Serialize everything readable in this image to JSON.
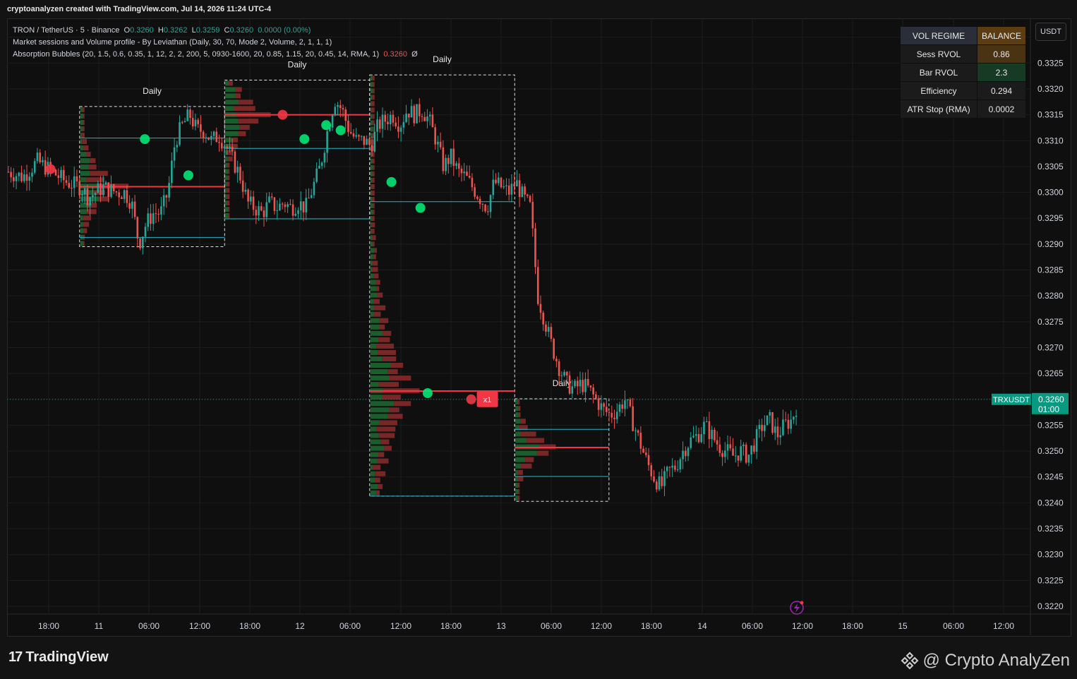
{
  "header": {
    "text": "cryptoanalyzen created with TradingView.com, Jul 14, 2026 11:24 UTC-4"
  },
  "legend": {
    "symbol_line": "TRON / TetherUS · 5 · Binance",
    "o_label": "O",
    "o_value": "0.3260",
    "h_label": "H",
    "h_value": "0.3262",
    "l_label": "L",
    "l_value": "0.3259",
    "c_label": "C",
    "c_value": "0.3260",
    "change": "0.0000 (0.00%)",
    "indicator1": "Market sessions and Volume profile - By Leviathan (Daily, 30, 70, Mode 2, Volume, 2, 1, 1, 1)",
    "indicator2": "Absorption Bubbles (20, 1.5, 0.6, 0.35, 1, 12, 2, 2, 200, 5, 0930-1600, 20, 0.85, 1.15, 20, 0.45, 14, RMA, 1)",
    "indicator2_value": "0.3260",
    "indicator2_suffix": "Ø"
  },
  "currency_button": "USDT",
  "regime_table": {
    "header": [
      "VOL REGIME",
      "BALANCE"
    ],
    "rows": [
      {
        "label": "Sess RVOL",
        "value": "0.86"
      },
      {
        "label": "Bar RVOL",
        "value": "2.3"
      },
      {
        "label": "Efficiency",
        "value": "0.294"
      },
      {
        "label": "ATR Stop (RMA)",
        "value": "0.0002"
      }
    ],
    "colors": {
      "header_bg": "#2a2e39",
      "balance_bg": "#5c3d12",
      "row_bg": "#1b1b1b",
      "sess_value_bg": "#4a3312",
      "bar_value_bg": "#173a24"
    }
  },
  "price_tag": {
    "symbol": "TRXUSDT",
    "price": "0.3260",
    "countdown": "01:00",
    "color": "#089981"
  },
  "session_label": "Daily",
  "marker_label": "x1",
  "footer": {
    "logo_text": "TradingView",
    "brand": "@ Crypto AnalyZen"
  },
  "colors": {
    "up": "#26a69a",
    "down": "#ef5350",
    "poc": "#f23645",
    "va": "#22b5c9",
    "bubble_green": "#00e676",
    "bubble_red": "#f23645"
  },
  "chart_data": {
    "type": "candlestick",
    "symbol": "TRXUSDT",
    "timeframe": "5",
    "ylim": [
      0.32185,
      0.33335
    ],
    "y_ticks": [
      "0.3330",
      "0.3325",
      "0.3320",
      "0.3315",
      "0.3310",
      "0.3305",
      "0.3300",
      "0.3295",
      "0.3290",
      "0.3285",
      "0.3280",
      "0.3275",
      "0.3270",
      "0.3265",
      "0.3260",
      "0.3255",
      "0.3250",
      "0.3245",
      "0.3240",
      "0.3235",
      "0.3230",
      "0.3225",
      "0.3220"
    ],
    "x_ticks": [
      "18:00",
      "11",
      "06:00",
      "12:00",
      "18:00",
      "12",
      "06:00",
      "12:00",
      "18:00",
      "13",
      "06:00",
      "12:00",
      "18:00",
      "14",
      "06:00",
      "12:00",
      "18:00",
      "15",
      "06:00",
      "12:00"
    ],
    "price_path": [
      [
        0,
        0.3304
      ],
      [
        2,
        0.3303
      ],
      [
        4,
        0.3306
      ],
      [
        6,
        0.3304
      ],
      [
        8,
        0.3302
      ],
      [
        10,
        0.3301
      ],
      [
        11,
        0.3299
      ],
      [
        13,
        0.3301
      ],
      [
        15,
        0.33
      ],
      [
        16,
        0.33
      ],
      [
        17,
        0.3298
      ],
      [
        18,
        0.329
      ],
      [
        19,
        0.3294
      ],
      [
        20,
        0.3296
      ],
      [
        21,
        0.3296
      ],
      [
        22,
        0.33
      ],
      [
        23,
        0.331
      ],
      [
        24,
        0.3313
      ],
      [
        25,
        0.3315
      ],
      [
        26,
        0.3312
      ],
      [
        27,
        0.3312
      ],
      [
        28,
        0.331
      ],
      [
        29,
        0.3311
      ],
      [
        30,
        0.3309
      ],
      [
        31,
        0.3306
      ],
      [
        32,
        0.3303
      ],
      [
        33,
        0.3298
      ],
      [
        34,
        0.3297
      ],
      [
        35,
        0.3296
      ],
      [
        36,
        0.3298
      ],
      [
        37,
        0.3297
      ],
      [
        38,
        0.3298
      ],
      [
        39,
        0.3297
      ],
      [
        40,
        0.3298
      ],
      [
        41,
        0.3297
      ],
      [
        42,
        0.3301
      ],
      [
        43,
        0.3305
      ],
      [
        44,
        0.3312
      ],
      [
        45,
        0.3318
      ],
      [
        46,
        0.3316
      ],
      [
        47,
        0.3312
      ],
      [
        48,
        0.331
      ],
      [
        49,
        0.331
      ],
      [
        50,
        0.3309
      ],
      [
        51,
        0.3313
      ],
      [
        52,
        0.3314
      ],
      [
        53,
        0.3315
      ],
      [
        54,
        0.3313
      ],
      [
        55,
        0.3316
      ],
      [
        56,
        0.3315
      ],
      [
        57,
        0.3316
      ],
      [
        58,
        0.3314
      ],
      [
        59,
        0.331
      ],
      [
        60,
        0.3305
      ],
      [
        61,
        0.3307
      ],
      [
        62,
        0.3304
      ],
      [
        63,
        0.3303
      ],
      [
        64,
        0.3301
      ],
      [
        65,
        0.3299
      ],
      [
        66,
        0.3297
      ],
      [
        67,
        0.3302
      ],
      [
        68,
        0.3301
      ],
      [
        69,
        0.33
      ],
      [
        70,
        0.3302
      ],
      [
        71,
        0.3299
      ],
      [
        72,
        0.3297
      ],
      [
        73,
        0.328
      ],
      [
        74,
        0.3275
      ],
      [
        75,
        0.327
      ],
      [
        76,
        0.3266
      ],
      [
        77,
        0.3263
      ],
      [
        78,
        0.3262
      ],
      [
        79,
        0.3263
      ],
      [
        80,
        0.3262
      ],
      [
        81,
        0.326
      ],
      [
        82,
        0.3258
      ],
      [
        83,
        0.3257
      ],
      [
        84,
        0.3258
      ],
      [
        85,
        0.326
      ],
      [
        86,
        0.3256
      ],
      [
        87,
        0.3252
      ],
      [
        88,
        0.3248
      ],
      [
        89,
        0.3245
      ],
      [
        90,
        0.3243
      ],
      [
        91,
        0.3246
      ],
      [
        92,
        0.3247
      ],
      [
        93,
        0.325
      ],
      [
        94,
        0.3252
      ],
      [
        95,
        0.3253
      ],
      [
        96,
        0.3255
      ],
      [
        97,
        0.3253
      ],
      [
        98,
        0.3251
      ],
      [
        99,
        0.325
      ],
      [
        100,
        0.3249
      ],
      [
        101,
        0.325
      ],
      [
        102,
        0.3249
      ],
      [
        103,
        0.3252
      ],
      [
        104,
        0.3255
      ],
      [
        105,
        0.3256
      ],
      [
        106,
        0.3253
      ],
      [
        107,
        0.3255
      ],
      [
        108,
        0.3256
      ],
      [
        109,
        0.326
      ]
    ],
    "sessions": [
      {
        "start": 10,
        "end": 30,
        "high": 0.33166,
        "low": 0.32895,
        "poc": 0.33011,
        "vah": 0.33105,
        "val": 0.32913
      },
      {
        "start": 30,
        "end": 50,
        "high": 0.33217,
        "low": 0.32949,
        "poc": 0.3315,
        "vah": 0.33085,
        "val": 0.32949
      },
      {
        "start": 50,
        "end": 70,
        "high": 0.33227,
        "low": 0.32413,
        "poc": 0.32616,
        "vah": 0.32982,
        "val": 0.32413
      },
      {
        "start": 70,
        "end": 83,
        "high": 0.32601,
        "low": 0.32403,
        "poc": 0.32507,
        "vah": 0.32542,
        "val": 0.32451
      }
    ],
    "bubbles": [
      {
        "i": 6,
        "price": 0.33045,
        "color": "red"
      },
      {
        "i": 19,
        "price": 0.33103,
        "color": "green"
      },
      {
        "i": 25,
        "price": 0.33033,
        "color": "green"
      },
      {
        "i": 38,
        "price": 0.3315,
        "color": "red"
      },
      {
        "i": 41,
        "price": 0.33103,
        "color": "green"
      },
      {
        "i": 44,
        "price": 0.3313,
        "color": "green"
      },
      {
        "i": 46,
        "price": 0.3312,
        "color": "green"
      },
      {
        "i": 53,
        "price": 0.3302,
        "color": "green"
      },
      {
        "i": 57,
        "price": 0.3297,
        "color": "green"
      },
      {
        "i": 58,
        "price": 0.32612,
        "color": "green"
      },
      {
        "i": 64,
        "price": 0.326,
        "color": "red"
      }
    ],
    "current_price": 0.326
  }
}
